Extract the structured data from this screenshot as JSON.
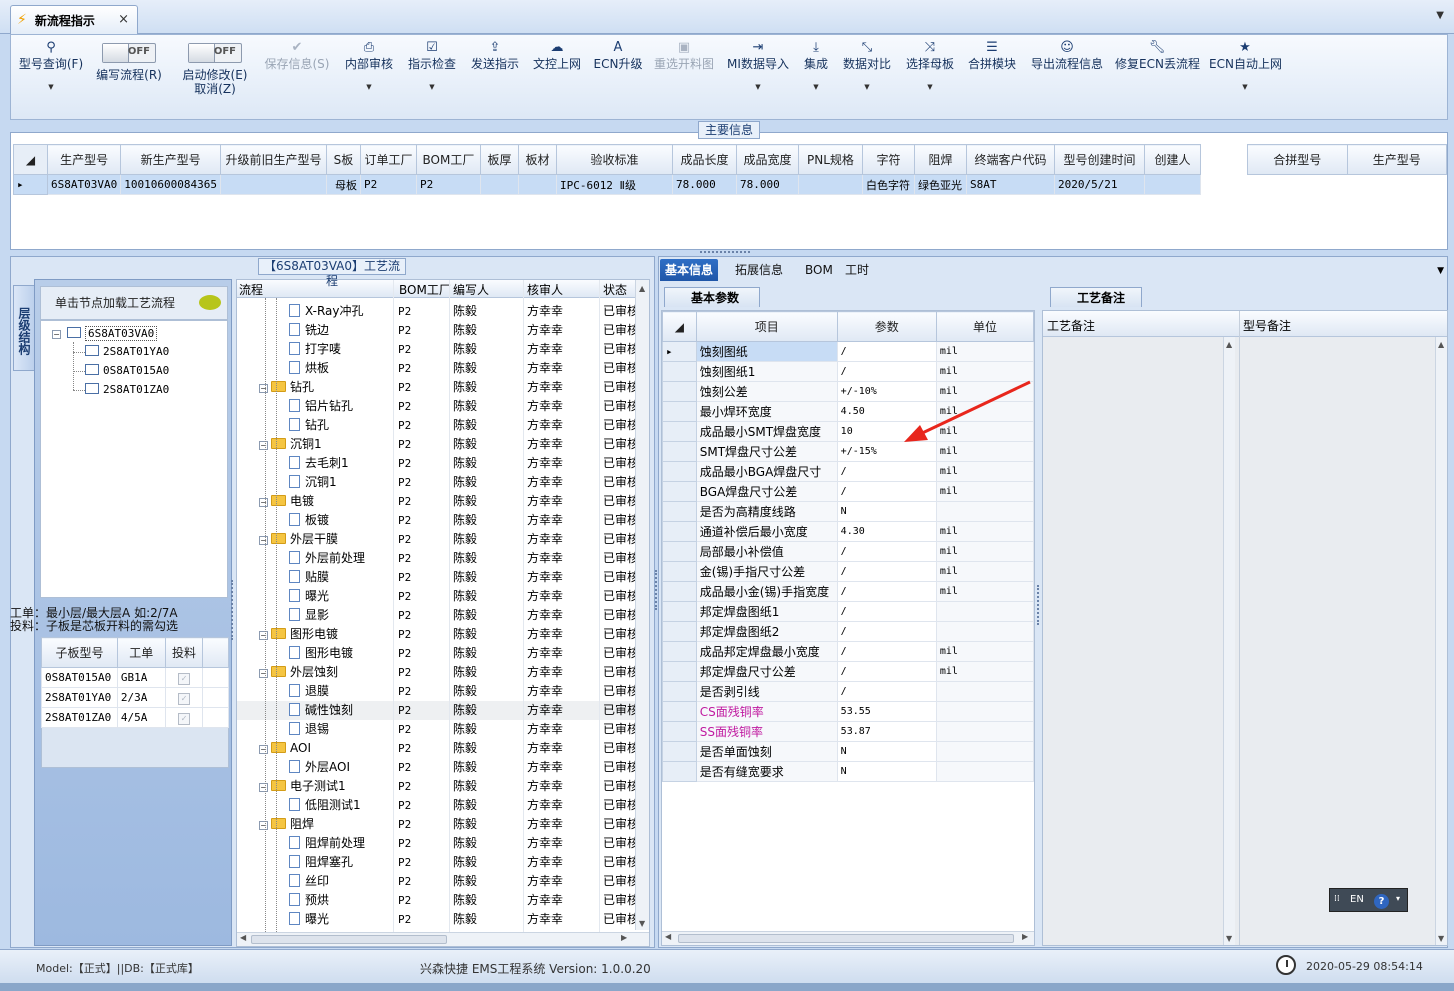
{
  "tab": {
    "title": "新流程指示",
    "close": "×"
  },
  "ribbon": {
    "query": {
      "label": "型号查询(F)"
    },
    "edit_flow": {
      "label": "编写流程(R)",
      "toggle": "OFF"
    },
    "auto_modify": {
      "label": "启动修改(E)",
      "sub": "取消(Z)",
      "toggle": "OFF"
    },
    "save": {
      "label": "保存信息(S)"
    },
    "internal_review": {
      "label": "内部审核"
    },
    "check": {
      "label": "指示检查"
    },
    "send": {
      "label": "发送指示"
    },
    "upload": {
      "label": "文控上网"
    },
    "ecn_upgrade": {
      "label": "ECN升级"
    },
    "reselect": {
      "label": "重选开料图"
    },
    "mi_import": {
      "label": "MI数据导入"
    },
    "integrate": {
      "label": "集成"
    },
    "compare": {
      "label": "数据对比"
    },
    "choose_mother": {
      "label": "选择母板"
    },
    "merge_module": {
      "label": "合拼模块"
    },
    "export": {
      "label": "导出流程信息"
    },
    "repair_ecn": {
      "label": "修复ECN丢流程"
    },
    "ecn_auto": {
      "label": "ECN自动上网"
    }
  },
  "main_info": {
    "caption": "主要信息",
    "columns": [
      "生产型号",
      "新生产型号",
      "升级前旧生产型号",
      "S板",
      "订单工厂",
      "BOM工厂",
      "板厚",
      "板材",
      "验收标准",
      "成品长度",
      "成品宽度",
      "PNL规格",
      "字符",
      "阻焊",
      "终端客户代码",
      "型号创建时间",
      "创建人"
    ],
    "row": [
      "6S8AT03VA0",
      "10010600084365",
      "",
      "母板",
      "P2",
      "P2",
      "",
      "",
      "IPC-6012 Ⅱ级",
      "78.000",
      "78.000",
      "",
      "白色字符",
      "绿色亚光",
      "S8AT",
      "2020/5/21",
      ""
    ]
  },
  "merge": {
    "columns": [
      "合拼型号",
      "生产型号"
    ]
  },
  "flow_caption": "【6S8AT03VA0】工艺流程",
  "structure": {
    "vtab": "层级结构",
    "hint": "单击节点加载工艺流程",
    "root": "6S8AT03VA0",
    "children": [
      "2S8AT01YA0",
      "0S8AT015A0",
      "2S8AT01ZA0"
    ],
    "note1": "工单：最小层/最大层A 如:2/7A",
    "note2": "投料：子板是芯板开料的需勾选",
    "sub_columns": [
      "子板型号",
      "工单",
      "投料"
    ],
    "sub_rows": [
      [
        "0S8AT015A0",
        "GB1A"
      ],
      [
        "2S8AT01YA0",
        "2/3A"
      ],
      [
        "2S8AT01ZA0",
        "4/5A"
      ]
    ],
    "check": "✓"
  },
  "flow": {
    "columns": [
      "流程",
      "BOM工厂",
      "编写人",
      "核审人",
      "状态"
    ],
    "rows": [
      {
        "name": "X-Ray冲孔",
        "lvl": 2,
        "bom": "P2",
        "writer": "陈毅",
        "reviewer": "方幸幸",
        "status": "已审核"
      },
      {
        "name": "铣边",
        "lvl": 2,
        "bom": "P2",
        "writer": "陈毅",
        "reviewer": "方幸幸",
        "status": "已审核"
      },
      {
        "name": "打字唛",
        "lvl": 2,
        "bom": "P2",
        "writer": "陈毅",
        "reviewer": "方幸幸",
        "status": "已审核"
      },
      {
        "name": "烘板",
        "lvl": 2,
        "bom": "P2",
        "writer": "陈毅",
        "reviewer": "方幸幸",
        "status": "已审核"
      },
      {
        "name": "钻孔",
        "lvl": 1,
        "bom": "P2",
        "writer": "陈毅",
        "reviewer": "方幸幸",
        "status": "已审核"
      },
      {
        "name": "铝片钻孔",
        "lvl": 2,
        "bom": "P2",
        "writer": "陈毅",
        "reviewer": "方幸幸",
        "status": "已审核"
      },
      {
        "name": "钻孔",
        "lvl": 2,
        "bom": "P2",
        "writer": "陈毅",
        "reviewer": "方幸幸",
        "status": "已审核"
      },
      {
        "name": "沉铜1",
        "lvl": 1,
        "bom": "P2",
        "writer": "陈毅",
        "reviewer": "方幸幸",
        "status": "已审核"
      },
      {
        "name": "去毛刺1",
        "lvl": 2,
        "bom": "P2",
        "writer": "陈毅",
        "reviewer": "方幸幸",
        "status": "已审核"
      },
      {
        "name": "沉铜1",
        "lvl": 2,
        "bom": "P2",
        "writer": "陈毅",
        "reviewer": "方幸幸",
        "status": "已审核"
      },
      {
        "name": "电镀",
        "lvl": 1,
        "bom": "P2",
        "writer": "陈毅",
        "reviewer": "方幸幸",
        "status": "已审核"
      },
      {
        "name": "板镀",
        "lvl": 2,
        "bom": "P2",
        "writer": "陈毅",
        "reviewer": "方幸幸",
        "status": "已审核"
      },
      {
        "name": "外层干膜",
        "lvl": 1,
        "bom": "P2",
        "writer": "陈毅",
        "reviewer": "方幸幸",
        "status": "已审核"
      },
      {
        "name": "外层前处理",
        "lvl": 2,
        "bom": "P2",
        "writer": "陈毅",
        "reviewer": "方幸幸",
        "status": "已审核"
      },
      {
        "name": "贴膜",
        "lvl": 2,
        "bom": "P2",
        "writer": "陈毅",
        "reviewer": "方幸幸",
        "status": "已审核"
      },
      {
        "name": "曝光",
        "lvl": 2,
        "bom": "P2",
        "writer": "陈毅",
        "reviewer": "方幸幸",
        "status": "已审核"
      },
      {
        "name": "显影",
        "lvl": 2,
        "bom": "P2",
        "writer": "陈毅",
        "reviewer": "方幸幸",
        "status": "已审核"
      },
      {
        "name": "图形电镀",
        "lvl": 1,
        "bom": "P2",
        "writer": "陈毅",
        "reviewer": "方幸幸",
        "status": "已审核"
      },
      {
        "name": "图形电镀",
        "lvl": 2,
        "bom": "P2",
        "writer": "陈毅",
        "reviewer": "方幸幸",
        "status": "已审核"
      },
      {
        "name": "外层蚀刻",
        "lvl": 1,
        "bom": "P2",
        "writer": "陈毅",
        "reviewer": "方幸幸",
        "status": "已审核"
      },
      {
        "name": "退膜",
        "lvl": 2,
        "bom": "P2",
        "writer": "陈毅",
        "reviewer": "方幸幸",
        "status": "已审核"
      },
      {
        "name": "碱性蚀刻",
        "lvl": 2,
        "bom": "P2",
        "writer": "陈毅",
        "reviewer": "方幸幸",
        "status": "已审核",
        "hl": true
      },
      {
        "name": "退锡",
        "lvl": 2,
        "bom": "P2",
        "writer": "陈毅",
        "reviewer": "方幸幸",
        "status": "已审核"
      },
      {
        "name": "AOI",
        "lvl": 1,
        "bom": "P2",
        "writer": "陈毅",
        "reviewer": "方幸幸",
        "status": "已审核"
      },
      {
        "name": "外层AOI",
        "lvl": 2,
        "bom": "P2",
        "writer": "陈毅",
        "reviewer": "方幸幸",
        "status": "已审核"
      },
      {
        "name": "电子测试1",
        "lvl": 1,
        "bom": "P2",
        "writer": "陈毅",
        "reviewer": "方幸幸",
        "status": "已审核"
      },
      {
        "name": "低阻测试1",
        "lvl": 2,
        "bom": "P2",
        "writer": "陈毅",
        "reviewer": "方幸幸",
        "status": "已审核"
      },
      {
        "name": "阻焊",
        "lvl": 1,
        "bom": "P2",
        "writer": "陈毅",
        "reviewer": "方幸幸",
        "status": "已审核"
      },
      {
        "name": "阻焊前处理",
        "lvl": 2,
        "bom": "P2",
        "writer": "陈毅",
        "reviewer": "方幸幸",
        "status": "已审核"
      },
      {
        "name": "阻焊塞孔",
        "lvl": 2,
        "bom": "P2",
        "writer": "陈毅",
        "reviewer": "方幸幸",
        "status": "已审核"
      },
      {
        "name": "丝印",
        "lvl": 2,
        "bom": "P2",
        "writer": "陈毅",
        "reviewer": "方幸幸",
        "status": "已审核"
      },
      {
        "name": "预烘",
        "lvl": 2,
        "bom": "P2",
        "writer": "陈毅",
        "reviewer": "方幸幸",
        "status": "已审核"
      },
      {
        "name": "曝光",
        "lvl": 2,
        "bom": "P2",
        "writer": "陈毅",
        "reviewer": "方幸幸",
        "status": "已审核"
      }
    ]
  },
  "right_tabs": [
    "基本信息",
    "拓展信息",
    "BOM",
    "工时"
  ],
  "basic_params": {
    "caption": "基本参数",
    "columns": [
      "项目",
      "参数",
      "单位"
    ],
    "rows": [
      {
        "item": "蚀刻图纸",
        "value": "/",
        "unit": "mil"
      },
      {
        "item": "蚀刻图纸1",
        "value": "/",
        "unit": "mil"
      },
      {
        "item": "蚀刻公差",
        "value": "+/-10%",
        "unit": "mil"
      },
      {
        "item": "最小焊环宽度",
        "value": "4.50",
        "unit": "mil"
      },
      {
        "item": "成品最小SMT焊盘宽度",
        "value": "10",
        "unit": "mil"
      },
      {
        "item": "SMT焊盘尺寸公差",
        "value": "+/-15%",
        "unit": "mil"
      },
      {
        "item": "成品最小BGA焊盘尺寸",
        "value": "/",
        "unit": "mil"
      },
      {
        "item": "BGA焊盘尺寸公差",
        "value": "/",
        "unit": "mil"
      },
      {
        "item": "是否为高精度线路",
        "value": "N",
        "unit": ""
      },
      {
        "item": "通道补偿后最小宽度",
        "value": "4.30",
        "unit": "mil"
      },
      {
        "item": "局部最小补偿值",
        "value": "/",
        "unit": "mil"
      },
      {
        "item": "金(锡)手指尺寸公差",
        "value": "/",
        "unit": "mil"
      },
      {
        "item": "成品最小金(锡)手指宽度",
        "value": "/",
        "unit": "mil"
      },
      {
        "item": "邦定焊盘图纸1",
        "value": "/",
        "unit": ""
      },
      {
        "item": "邦定焊盘图纸2",
        "value": "/",
        "unit": ""
      },
      {
        "item": "成品邦定焊盘最小宽度",
        "value": "/",
        "unit": "mil"
      },
      {
        "item": "邦定焊盘尺寸公差",
        "value": "/",
        "unit": "mil"
      },
      {
        "item": "是否剥引线",
        "value": "/",
        "unit": ""
      },
      {
        "item": "CS面残铜率",
        "value": "53.55",
        "unit": "",
        "mag": true
      },
      {
        "item": "SS面残铜率",
        "value": "53.87",
        "unit": "",
        "mag": true
      },
      {
        "item": "是否单面蚀刻",
        "value": "N",
        "unit": ""
      },
      {
        "item": "是否有缝宽要求",
        "value": "N",
        "unit": ""
      }
    ]
  },
  "remarks": {
    "caption": "工艺备注",
    "columns": [
      "工艺备注",
      "型号备注"
    ]
  },
  "status": {
    "model": "Model:【正式】||DB:【正式库】",
    "system": "兴森快捷 EMS工程系统 Version: 1.0.0.20",
    "datetime": "2020-05-29 08:54:14"
  },
  "langbar": {
    "lang": "EN",
    "help": "?"
  },
  "colors": {
    "accent": "#1f56a8",
    "arrow": "#e8261c",
    "magenta": "#c01aa0"
  }
}
